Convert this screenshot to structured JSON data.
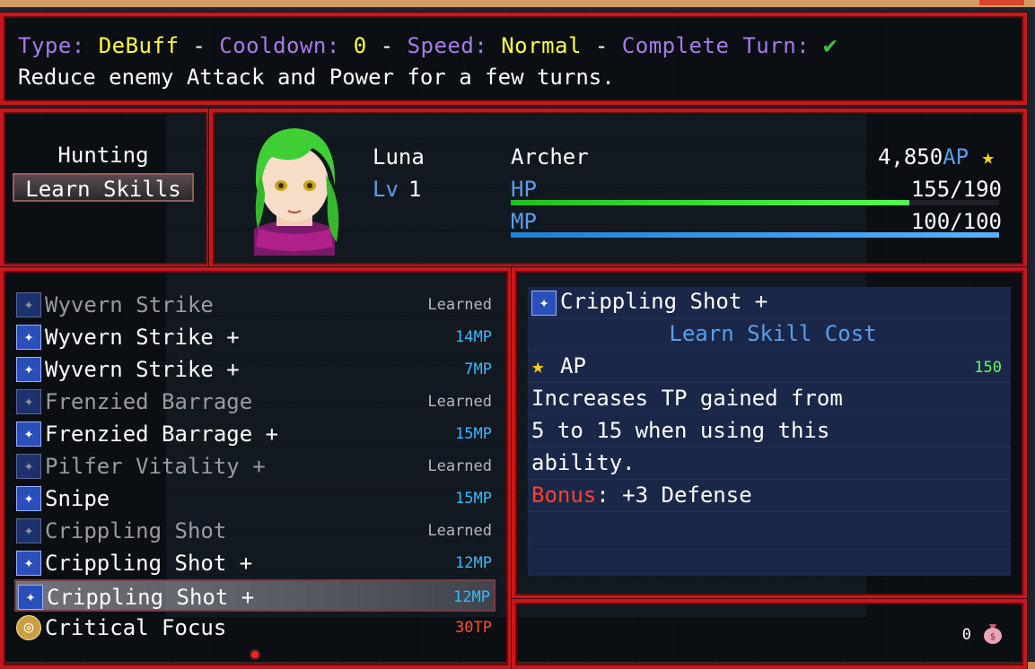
{
  "help": {
    "type_label": "Type:",
    "type_value": "DeBuff",
    "cooldown_label": "Cooldown:",
    "cooldown_value": "0",
    "speed_label": "Speed:",
    "speed_value": "Normal",
    "complete_label": "Complete Turn:",
    "complete_icon": "checkmark-icon",
    "description": "Reduce enemy Attack and Power for a few turns."
  },
  "command": {
    "hunting": "Hunting",
    "learn_skills": "Learn Skills"
  },
  "actor": {
    "name": "Luna",
    "level_label": "Lv",
    "level": "1",
    "class": "Archer",
    "ap": "4,850",
    "ap_label": "AP",
    "hp_label": "HP",
    "hp_text": "155/190",
    "hp_ratio": 0.8158,
    "mp_label": "MP",
    "mp_text": "100/100",
    "mp_ratio": 1.0
  },
  "skills": [
    {
      "name": "Wyvern Strike",
      "cost": "Learned",
      "state": "learned"
    },
    {
      "name": "Wyvern Strike +",
      "cost": "14MP",
      "state": "mp"
    },
    {
      "name": "Wyvern Strike +",
      "cost": "7MP",
      "state": "mp"
    },
    {
      "name": "Frenzied Barrage",
      "cost": "Learned",
      "state": "learned"
    },
    {
      "name": "Frenzied Barrage +",
      "cost": "15MP",
      "state": "mp"
    },
    {
      "name": "Pilfer Vitality +",
      "cost": "Learned",
      "state": "learned"
    },
    {
      "name": "Snipe",
      "cost": "15MP",
      "state": "mp"
    },
    {
      "name": "Crippling Shot",
      "cost": "Learned",
      "state": "learned"
    },
    {
      "name": "Crippling Shot +",
      "cost": "12MP",
      "state": "mp"
    },
    {
      "name": "Crippling Shot +",
      "cost": "12MP",
      "state": "selected"
    },
    {
      "name": "Critical Focus",
      "cost": "30TP",
      "state": "tp"
    }
  ],
  "detail": {
    "skill_name": "Crippling Shot +",
    "cost_title": "Learn Skill Cost",
    "ap_label": "AP",
    "ap_cost": "150",
    "desc1": "Increases TP gained from",
    "desc2": "5 to 15 when using this",
    "desc3": "ability.",
    "bonus_label": "Bonus",
    "bonus_value": ": +3 Defense"
  },
  "gold": {
    "amount": "0",
    "icon": "money-bag-icon"
  },
  "colors": {
    "frame": "#c9161c",
    "system_text": "#5a9eea",
    "hp": "#20c020",
    "mp": "#2080d0"
  }
}
